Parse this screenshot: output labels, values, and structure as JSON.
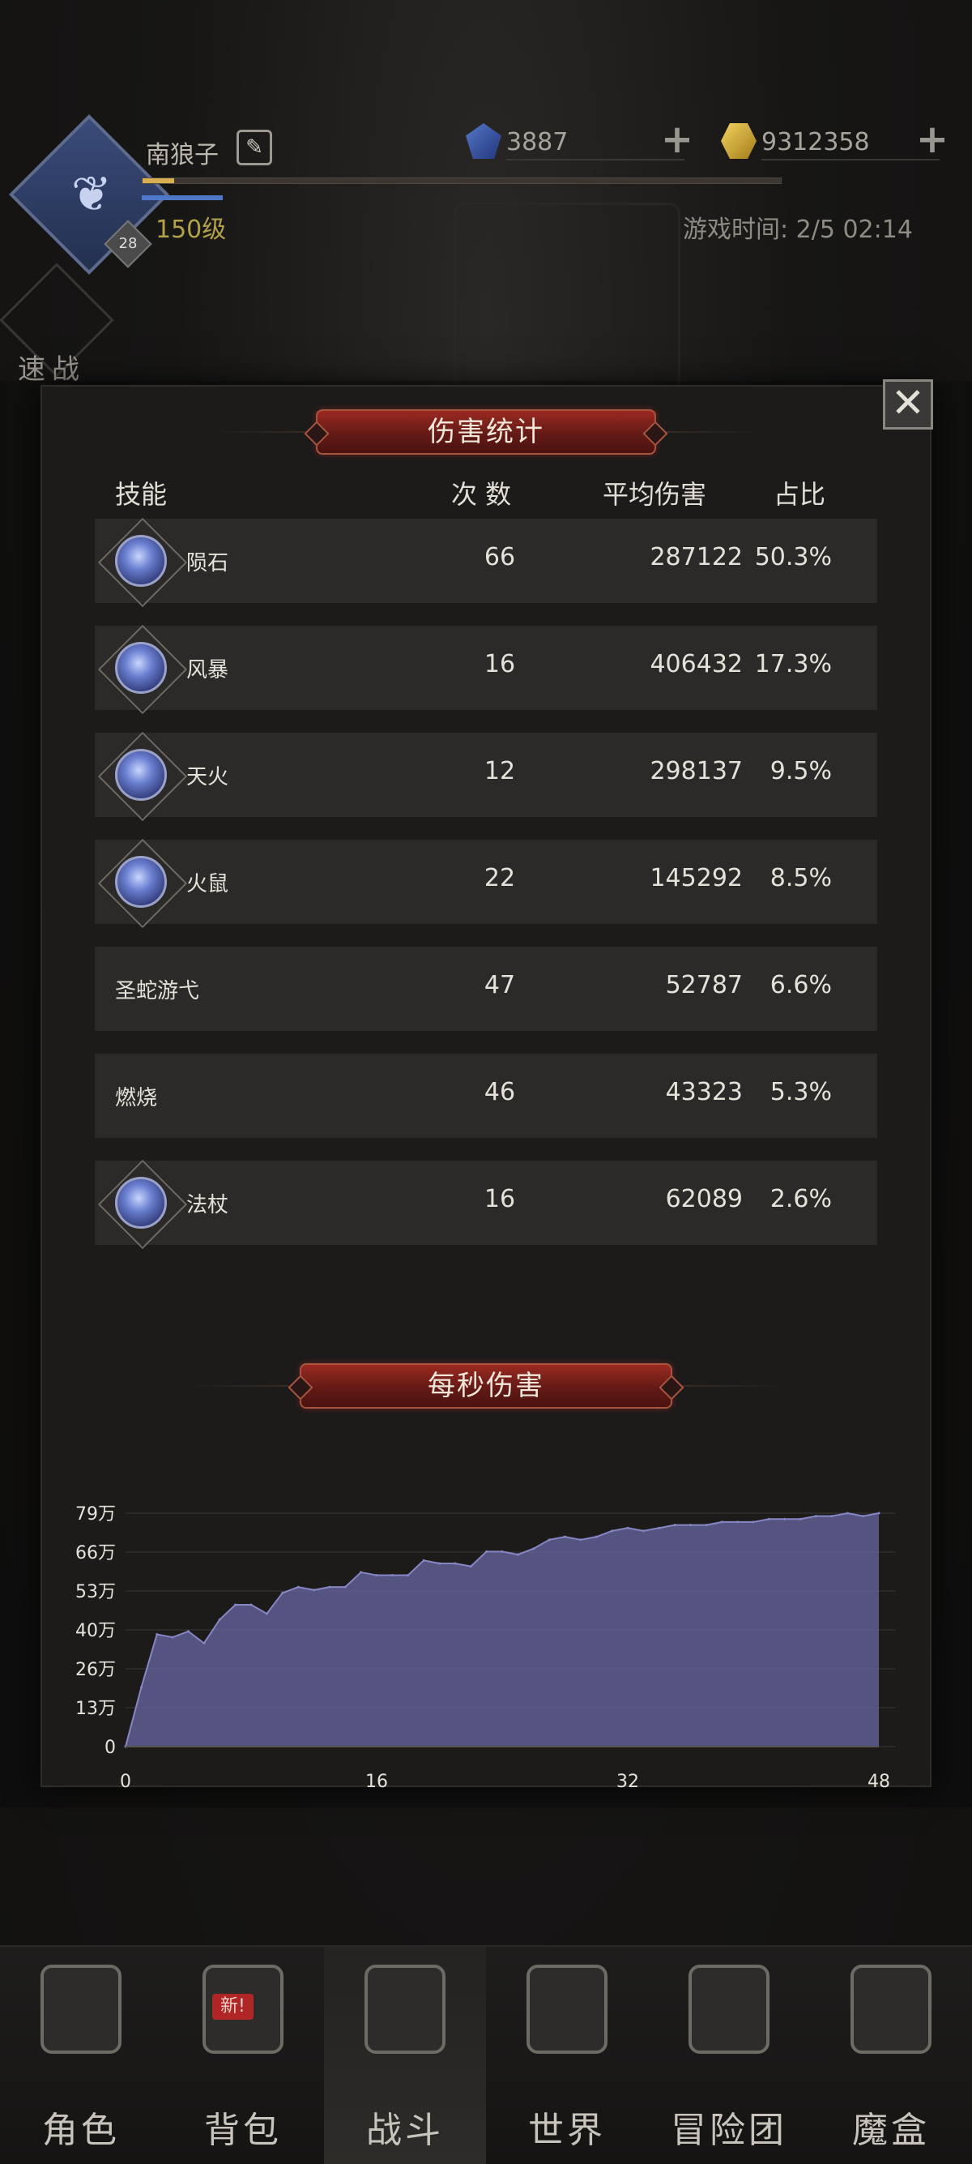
{
  "player": {
    "name": "南狼子",
    "level": "150级",
    "avatar_badge": "28",
    "xp_fraction": 0.05
  },
  "currency": {
    "gems": "3887",
    "gold": "9312358"
  },
  "game_time": "游戏时间: 2/5 02:14",
  "quick_battle": {
    "label": "速战"
  },
  "damage_stats": {
    "title": "伤害统计",
    "headers": {
      "skill": "技能",
      "count": "次 数",
      "avg": "平均伤害",
      "ratio": "占比"
    },
    "rows": [
      {
        "name": "陨石",
        "count": "66",
        "avg": "287122",
        "ratio": "50.3%",
        "icon": "meteor-icon"
      },
      {
        "name": "风暴",
        "count": "16",
        "avg": "406432",
        "ratio": "17.3%",
        "icon": "storm-icon"
      },
      {
        "name": "天火",
        "count": "12",
        "avg": "298137",
        "ratio": "9.5%",
        "icon": "skyfire-icon"
      },
      {
        "name": "火鼠",
        "count": "22",
        "avg": "145292",
        "ratio": "8.5%",
        "icon": "fire-rat-icon"
      },
      {
        "name": "圣蛇游弋",
        "count": "47",
        "avg": "52787",
        "ratio": "6.6%",
        "icon": ""
      },
      {
        "name": "燃烧",
        "count": "46",
        "avg": "43323",
        "ratio": "5.3%",
        "icon": ""
      },
      {
        "name": "法杖",
        "count": "16",
        "avg": "62089",
        "ratio": "2.6%",
        "icon": "staff-icon"
      }
    ]
  },
  "dps": {
    "title": "每秒伤害"
  },
  "chart_data": {
    "type": "area",
    "title": "每秒伤害",
    "xlabel": "",
    "ylabel": "",
    "xlim": [
      0,
      48
    ],
    "ylim": [
      0,
      79
    ],
    "x_ticks": [
      "0",
      "16",
      "32",
      "48"
    ],
    "y_ticks": [
      "0",
      "13万",
      "26万",
      "40万",
      "53万",
      "66万",
      "79万"
    ],
    "x": [
      0,
      1,
      2,
      3,
      4,
      5,
      6,
      7,
      8,
      9,
      10,
      11,
      12,
      13,
      14,
      15,
      16,
      17,
      18,
      19,
      20,
      21,
      22,
      23,
      24,
      25,
      26,
      27,
      28,
      29,
      30,
      31,
      32,
      33,
      34,
      35,
      36,
      37,
      38,
      39,
      40,
      41,
      42,
      43,
      44,
      45,
      46,
      47,
      48
    ],
    "values": [
      0,
      20,
      38,
      37,
      39,
      35,
      43,
      48,
      48,
      45,
      52,
      54,
      53,
      54,
      54,
      59,
      58,
      58,
      58,
      63,
      62,
      62,
      61,
      66,
      66,
      65,
      67,
      70,
      71,
      70,
      71,
      73,
      74,
      73,
      74,
      75,
      75,
      75,
      76,
      76,
      76,
      77,
      77,
      77,
      78,
      78,
      79,
      78,
      79
    ],
    "grid": true,
    "fill_color": "#5f5e94",
    "line_color": "#8686c4"
  },
  "nav": {
    "items": [
      {
        "label": "角色",
        "icon": "character-helmet-icon"
      },
      {
        "label": "背包",
        "icon": "backpack-icon",
        "badge": "新!"
      },
      {
        "label": "战斗",
        "icon": "battle-shield-icon"
      },
      {
        "label": "世界",
        "icon": "world-map-icon"
      },
      {
        "label": "冒险团",
        "icon": "guild-castle-icon"
      },
      {
        "label": "魔盒",
        "icon": "magic-box-icon"
      }
    ],
    "active_index": 2
  }
}
